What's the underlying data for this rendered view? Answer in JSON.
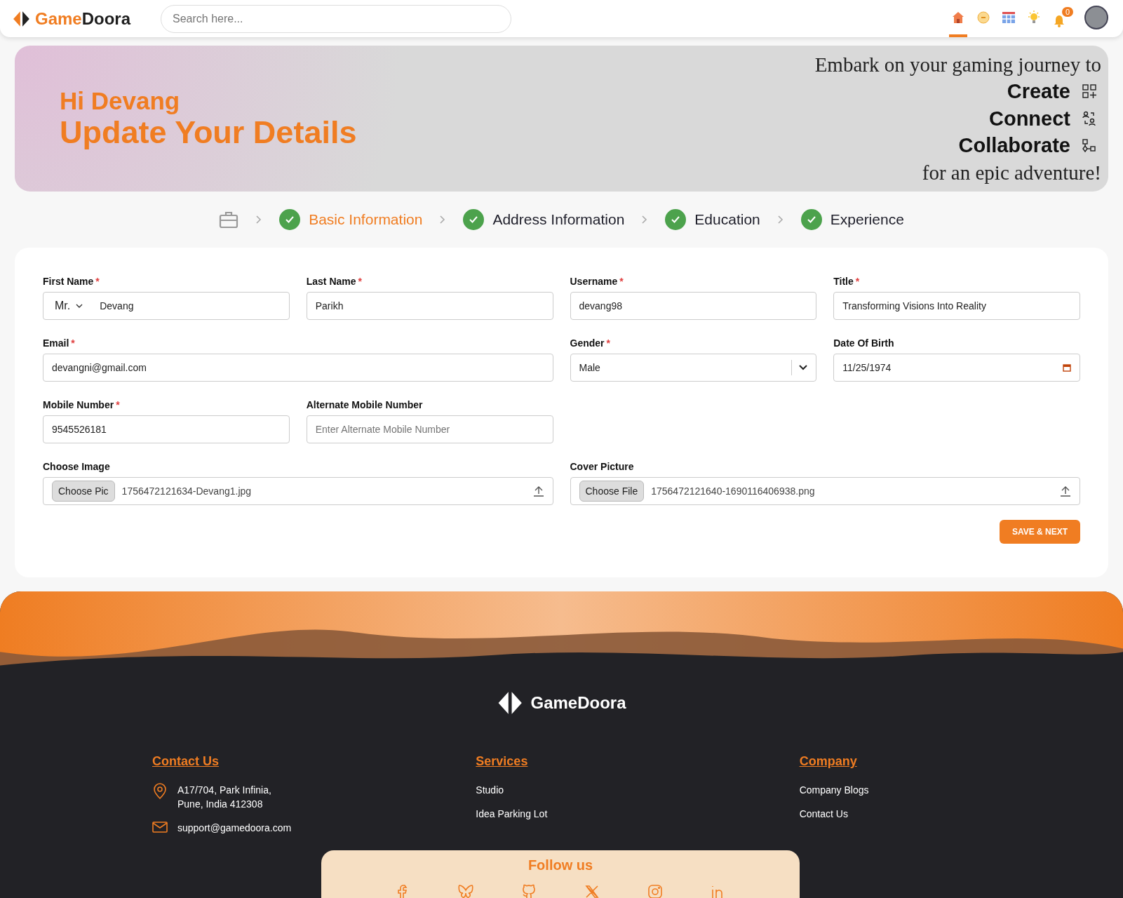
{
  "header": {
    "logo": {
      "game": "Game",
      "doora": "Doora"
    },
    "search": {
      "placeholder": "Search here..."
    },
    "nav": [
      {
        "kind": "home",
        "selected": true
      },
      {
        "kind": "coin",
        "selected": false
      },
      {
        "kind": "grid",
        "selected": false
      },
      {
        "kind": "bulb",
        "selected": false
      },
      {
        "kind": "bell",
        "selected": false,
        "badge": "0"
      },
      {
        "kind": "avatar",
        "selected": false
      }
    ]
  },
  "banner": {
    "greeting": "Hi Devang",
    "heading": "Update Your Details",
    "intro": "Embark on your gaming journey to",
    "words": [
      {
        "text": "Create",
        "kind": "create"
      },
      {
        "text": "Connect",
        "kind": "connect"
      },
      {
        "text": "Collaborate",
        "kind": "collaborate"
      }
    ],
    "outro": "for an epic adventure!"
  },
  "steps": [
    {
      "label": "Basic Information",
      "done": true,
      "selected": true
    },
    {
      "label": "Address Information",
      "done": true,
      "selected": false
    },
    {
      "label": "Education",
      "done": true,
      "selected": false
    },
    {
      "label": "Experience",
      "done": true,
      "selected": false
    }
  ],
  "form": {
    "required_mark": "*",
    "fields": [
      {
        "kind": "prefix",
        "label": "First Name",
        "required": true,
        "prefix": "Mr.",
        "value": "Devang"
      },
      {
        "kind": "text",
        "label": "Last Name",
        "required": true,
        "value": "Parikh"
      },
      {
        "kind": "text",
        "label": "Username",
        "required": true,
        "value": "devang98"
      },
      {
        "kind": "text",
        "label": "Title",
        "required": true,
        "value": "Transforming Visions Into Reality"
      },
      {
        "kind": "email",
        "label": "Email",
        "required": true,
        "value": "devangni@gmail.com"
      },
      {
        "kind": "select",
        "label": "Gender",
        "required": true,
        "value": "Male"
      },
      {
        "kind": "date",
        "label": "Date Of Birth",
        "required": false,
        "value": "11/25/1974"
      },
      {
        "kind": "text",
        "label": "Mobile Number",
        "required": true,
        "value": "9545526181"
      },
      {
        "kind": "text",
        "label": "Alternate Mobile Number",
        "required": false,
        "placeholder": "Enter Alternate Mobile Number"
      }
    ],
    "uploads": [
      {
        "label": "Choose Image",
        "required": false,
        "button": "Choose Pic",
        "value": "1756472121634-Devang1.jpg"
      },
      {
        "label": "Cover Picture",
        "required": false,
        "button": "Choose File",
        "value": "1756472121640-1690116406938.png"
      }
    ],
    "submit": "SAVE & NEXT"
  },
  "footer": {
    "logo": "GameDoora",
    "columns": [
      {
        "heading": "Contact Us",
        "items": [
          {
            "kind": "address",
            "text": "A17/704, Park Infinia,\nPune, India 412308"
          },
          {
            "kind": "email",
            "text": "support@gamedoora.com"
          }
        ]
      },
      {
        "heading": "Services",
        "items": [
          {
            "kind": "link",
            "text": "Studio"
          },
          {
            "kind": "link",
            "text": "Idea Parking Lot"
          }
        ]
      },
      {
        "heading": "Company",
        "items": [
          {
            "kind": "link",
            "text": "Company Blogs"
          },
          {
            "kind": "link",
            "text": "Contact Us"
          }
        ]
      }
    ],
    "follow": {
      "title": "Follow us",
      "icons": [
        {
          "kind": "facebook"
        },
        {
          "kind": "butterfly"
        },
        {
          "kind": "github"
        },
        {
          "kind": "x"
        },
        {
          "kind": "instagram"
        },
        {
          "kind": "linkedin"
        }
      ]
    }
  }
}
